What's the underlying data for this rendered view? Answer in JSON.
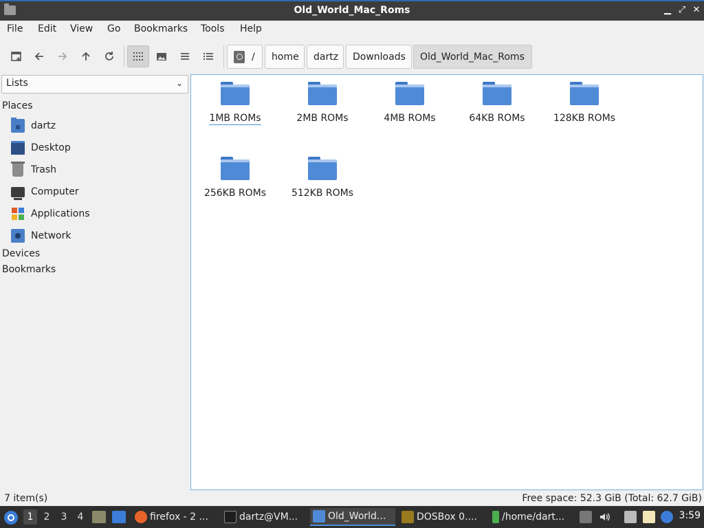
{
  "window": {
    "title": "Old_World_Mac_Roms"
  },
  "menu": {
    "items": [
      "File",
      "Edit",
      "View",
      "Go",
      "Bookmarks",
      "Tools",
      "Help"
    ]
  },
  "toolbar": {
    "buttons": [
      "new-tab",
      "back",
      "forward",
      "up",
      "reload",
      "icon-view",
      "thumbnail-view",
      "compact-view",
      "detailed-list-view"
    ],
    "active_view": "icon-view"
  },
  "breadcrumb": {
    "root": "/",
    "segments": [
      "home",
      "dartz",
      "Downloads",
      "Old_World_Mac_Roms"
    ]
  },
  "sidebar": {
    "mode": "Lists",
    "places_label": "Places",
    "places": [
      {
        "label": "dartz",
        "icon": "home-folder-icon"
      },
      {
        "label": "Desktop",
        "icon": "desktop-icon"
      },
      {
        "label": "Trash",
        "icon": "trash-icon"
      },
      {
        "label": "Computer",
        "icon": "computer-icon"
      },
      {
        "label": "Applications",
        "icon": "applications-icon"
      },
      {
        "label": "Network",
        "icon": "network-icon"
      }
    ],
    "devices_label": "Devices",
    "bookmarks_label": "Bookmarks"
  },
  "files": [
    {
      "name": "1MB ROMs",
      "type": "folder"
    },
    {
      "name": "2MB ROMs",
      "type": "folder"
    },
    {
      "name": "4MB ROMs",
      "type": "folder"
    },
    {
      "name": "64KB ROMs",
      "type": "folder"
    },
    {
      "name": "128KB ROMs",
      "type": "folder"
    },
    {
      "name": "256KB ROMs",
      "type": "folder"
    },
    {
      "name": "512KB ROMs",
      "type": "folder"
    }
  ],
  "status": {
    "items": "7 item(s)",
    "free_space": "Free space: 52.3 GiB (Total: 62.7 GiB)"
  },
  "taskbar": {
    "workspaces": [
      "1",
      "2",
      "3",
      "4"
    ],
    "active_workspace": "1",
    "tasks": [
      {
        "label": "firefox - 2 ...",
        "icon": "firefox-icon"
      },
      {
        "label": "dartz@VM...",
        "icon": "terminal-icon"
      },
      {
        "label": "Old_World...",
        "icon": "folder-icon"
      },
      {
        "label": "DOSBox 0....",
        "icon": "dosbox-icon"
      },
      {
        "label": "/home/dart...",
        "icon": "editor-icon"
      }
    ],
    "clock": "3:59"
  }
}
